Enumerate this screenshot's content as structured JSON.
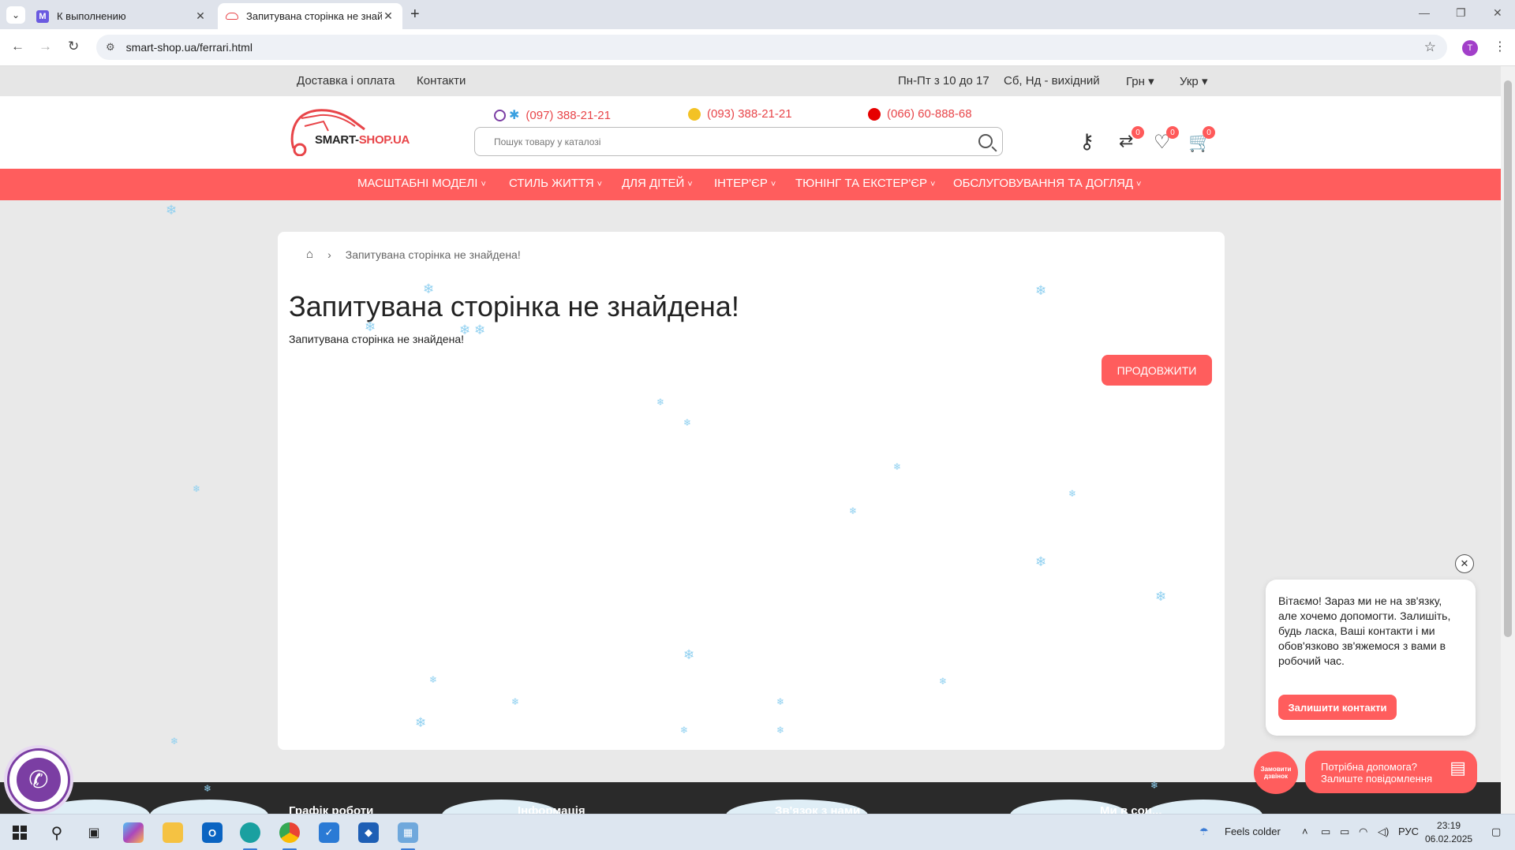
{
  "browser": {
    "tabs": [
      {
        "title": "К выполнению",
        "favicon": "M"
      },
      {
        "title": "Запитувана сторінка не знайд"
      }
    ],
    "url": "smart-shop.ua/ferrari.html",
    "profile_initial": "T"
  },
  "topbar": {
    "links": [
      "Доставка і оплата",
      "Контакти"
    ],
    "hours_weekday": "Пн-Пт з 10 до 17",
    "hours_weekend": "Сб, Нд - вихідний",
    "currency": "Грн",
    "language": "Укр"
  },
  "header": {
    "logo_text_a": "SMART-",
    "logo_text_b": "SHOP.UA",
    "phones": [
      "(097) 388-21-21",
      "(093) 388-21-21",
      "(066) 60-888-68"
    ],
    "search_placeholder": "Пошук товару у каталозі",
    "compare_count": "0",
    "wishlist_count": "0",
    "cart_count": "0"
  },
  "menu": [
    "Масштабні моделі",
    "Стиль життя",
    "Для дітей",
    "Інтер'єр",
    "Тюнінг та екстер'єр",
    "Обслуговування та догляд"
  ],
  "content": {
    "breadcrumb_current": "Запитувана сторінка не знайдена!",
    "heading": "Запитувана сторінка не знайдена!",
    "message": "Запитувана сторінка не знайдена!",
    "continue_label": "Продовжити"
  },
  "footer": {
    "cols": [
      "Графік роботи",
      "Інформація",
      "Зв'язок з нами",
      "Ми в соц..."
    ]
  },
  "chat": {
    "message": "Вітаємо! Зараз ми не на зв'язку, але хочемо допомогти. Залишіть, будь ласка, Ваші контакти і ми обов'язково зв'яжемося з вами в робочий час.",
    "leave_contacts": "Залишити контакти",
    "callback_label": "Замовити дзвінок",
    "help_line1": "Потрібна допомога?",
    "help_line2": "Залиште повідомлення"
  },
  "taskbar": {
    "weather": "Feels colder",
    "lang": "РУС",
    "time": "23:19",
    "date": "06.02.2025"
  },
  "colors": {
    "accent": "#ff5d5d",
    "phone": "#e84549",
    "viber": "#7b3ea3"
  }
}
